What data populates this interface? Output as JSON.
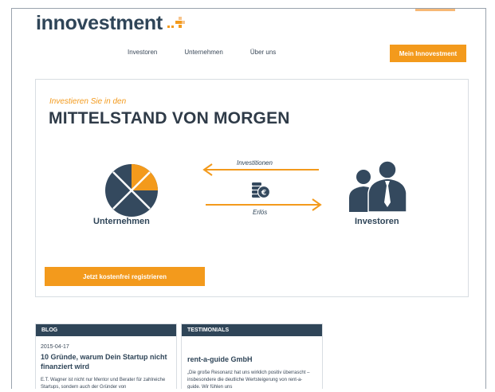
{
  "header": {
    "logo_text": "innovestment",
    "nav": [
      "Investoren",
      "Unternehmen",
      "Über uns"
    ],
    "cta_label": "Mein Innovestment",
    "brand_color": "#f39a1c",
    "navy_color": "#2f4558"
  },
  "hero": {
    "subtitle": "Investieren Sie in den",
    "title": "MITTELSTAND VON MORGEN",
    "left_label": "Unternehmen",
    "right_label": "Investoren",
    "arrow_top_label": "Investitionen",
    "arrow_bottom_label": "Erlös",
    "register_label": "Jetzt kostenfrei registrieren"
  },
  "blog": {
    "header": "BLOG",
    "date": "2015-04-17",
    "title": "10 Gründe, warum Dein Startup nicht finanziert wird",
    "excerpt": "E.T. Wagner ist nicht nur Mentor und Berater für zahlreiche Startups, sondern auch der Gründer von"
  },
  "testimonials": {
    "header": "TESTIMONIALS",
    "title": "rent-a-guide GmbH",
    "quote": "„Die große Resonanz hat uns wirklich positiv überrascht – insbesondere die deutliche Wertsteigerung von rent-a-guide. Wir fühlen uns"
  }
}
